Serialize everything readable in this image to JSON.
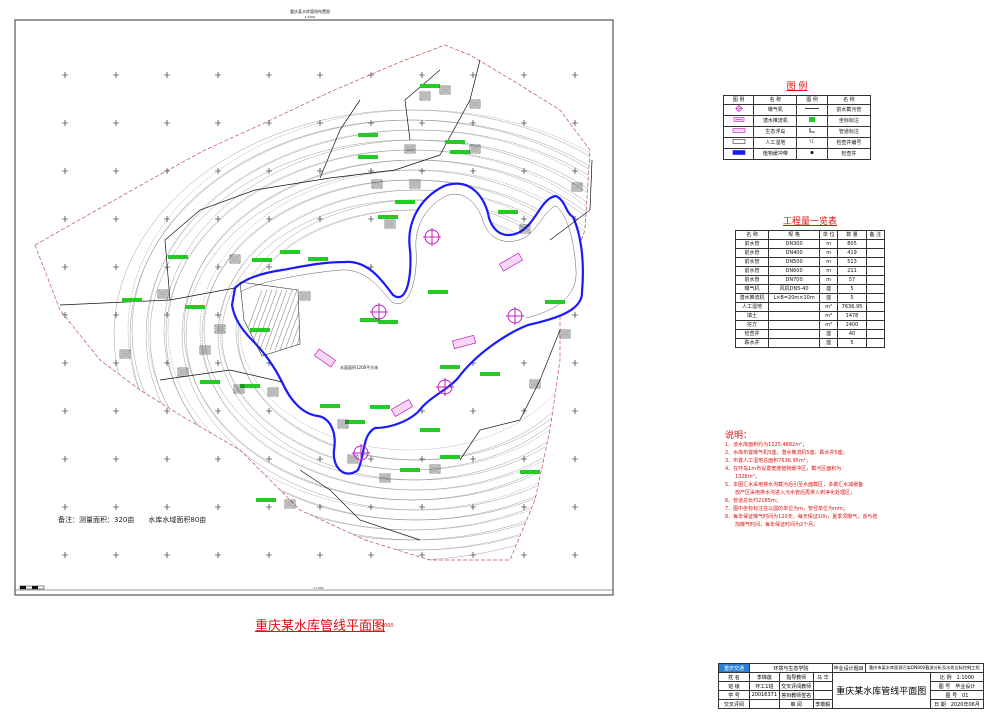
{
  "header": {
    "caption": "重庆某水库管线布置图",
    "subcaption": "1:1000"
  },
  "map": {
    "center_label": "水面面积1200平方米",
    "memo": "备注：测量面积：320亩　　水库水域面积80亩",
    "scale_bar_label": "1:1000",
    "colors": {
      "water": "#1a1aff",
      "pipe": "#111111",
      "tank": "#c020c0",
      "station": "#22cc22",
      "contour": "#666666"
    }
  },
  "legend": {
    "title": "图 例",
    "headers": [
      "图 例",
      "名 称",
      "图 例",
      "名 称"
    ],
    "rows": [
      {
        "name1": "曝气机",
        "name2": "前水截污管",
        "icon1": "aerator-icon",
        "icon2": "pipe-line-icon"
      },
      {
        "name1": "潜水推流机",
        "name2": "坐标标注",
        "icon1": "flow-pusher-icon",
        "icon2": "coordinate-mark-icon"
      },
      {
        "name1": "生态浮岛",
        "name2": "管道标注",
        "icon1": "floating-island-icon",
        "icon2": "pipe-mark-icon"
      },
      {
        "name1": "人工湿地",
        "name2": "检查井编号",
        "icon1": "wetland-icon",
        "icon2": "manhole-number-icon"
      },
      {
        "name1": "植物缓冲带",
        "name2": "检查井",
        "icon1": "buffer-belt-icon",
        "icon2": "manhole-icon"
      }
    ]
  },
  "quantities": {
    "title": "工程量一览表",
    "headers": [
      "名 称",
      "规 格",
      "单 位",
      "数 量",
      "备 注"
    ],
    "rows": [
      [
        "前水管",
        "DN300",
        "m",
        "805",
        ""
      ],
      [
        "前水管",
        "DN400",
        "m",
        "419",
        ""
      ],
      [
        "前水管",
        "DN500",
        "m",
        "513",
        ""
      ],
      [
        "前水管",
        "DN600",
        "m",
        "211",
        ""
      ],
      [
        "前水管",
        "DN700",
        "m",
        "57",
        ""
      ],
      [
        "曝气机",
        "风机DN5-40",
        "座",
        "5",
        ""
      ],
      [
        "潜水推流机",
        "L×B=20m×10m",
        "座",
        "5",
        ""
      ],
      [
        "人工湿地",
        "",
        "m²",
        "7636.95",
        ""
      ],
      [
        "填土",
        "",
        "m³",
        "1478",
        ""
      ],
      [
        "挖方",
        "",
        "m³",
        "2400",
        ""
      ],
      [
        "检查井",
        "",
        "座",
        "40",
        ""
      ],
      [
        "跌水井",
        "",
        "座",
        "5",
        ""
      ]
    ]
  },
  "notes": {
    "title": "说明：",
    "items": [
      "1、该水库面积约为1125.4682m²；",
      "2、水库布置曝气机5座，潜水推流机5座，跌水井5座；",
      "3、布置人工湿地总面积7636.95m²；",
      "4、在环岛1m布设置宽度植物缓冲区，截污区面积为",
      "　　1326m²；",
      "5、本图汇水采用排水沟截污后引至水面截区，多做汇水减缓备",
      "　　放产区采用排水沟进入污水管后再排入到净化处理区；",
      "6、管道总长约2185m；",
      "7、图中坐标标注在以圆的单位为m，管径单位为mm；",
      "8、每年保证曝气时间为120天，每天保证10h，夏季须曝气，该与增",
      "　　加曝气时间，每年保证时间为2个月。"
    ]
  },
  "main_title": {
    "text": "重庆某水库管线平面图",
    "scale": "1:1000"
  },
  "titleblock": {
    "school_logo": "重庆交通",
    "school": "环境与生态学院",
    "design_label": "毕业设计题目",
    "project": "重庆市某水库面源污染DN800截流分析及水质达标控制工程",
    "rows": [
      [
        "姓 名",
        "李锦莲",
        "指导教师",
        "马 华"
      ],
      [
        "班 级",
        "环工1班",
        "交叉评阅教师",
        ""
      ],
      [
        "学 号",
        "20016371",
        "答辩教师签名",
        ""
      ],
      [
        "交叉评阅",
        "",
        "审 阅",
        "李敬毅"
      ]
    ],
    "drawing_name": "重庆某水库管线平面图",
    "meta": [
      [
        "比 例",
        "1:1000"
      ],
      [
        "图 号",
        "毕业设计"
      ],
      [
        "图 号",
        "01"
      ],
      [
        "日 期",
        "2020年06月"
      ]
    ]
  }
}
